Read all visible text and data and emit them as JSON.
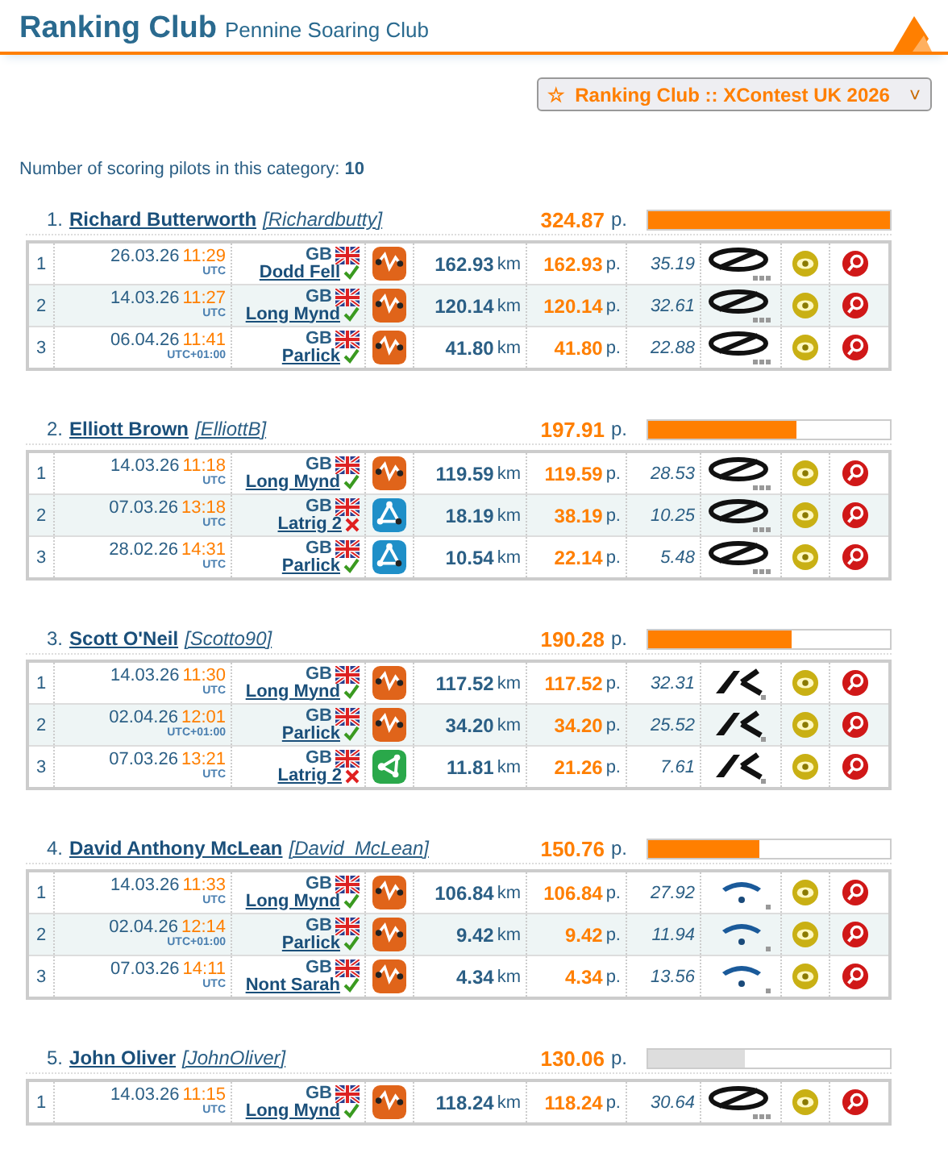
{
  "header": {
    "title": "Ranking Club",
    "subtitle": "Pennine Soaring Club"
  },
  "selector": {
    "star": "☆",
    "label": "Ranking Club :: XContest UK 2026",
    "caret": "˅"
  },
  "count": {
    "label": "Number of scoring pilots in this category:",
    "value": "10"
  },
  "pilots": [
    {
      "rank": "1.",
      "name": "Richard Butterworth",
      "username": "[Richardbutty]",
      "points": "324.87",
      "points_unit": "p.",
      "level": 1,
      "color": "#ff7f00",
      "flights": [
        {
          "num": "1",
          "date": "26.03.26",
          "time": "11:29",
          "tz": "UTC",
          "country": "GB",
          "site": "Dodd Fell",
          "valid": true,
          "route": {
            "kind": "free"
          },
          "distance": "162.93",
          "distance_unit": "km",
          "points": "162.93",
          "points_unit": "p.",
          "speed": "35.19",
          "glider": {
            "kind": "ozone"
          }
        },
        {
          "num": "2",
          "date": "14.03.26",
          "time": "11:27",
          "tz": "UTC",
          "country": "GB",
          "site": "Long Mynd",
          "valid": true,
          "route": {
            "kind": "free"
          },
          "distance": "120.14",
          "distance_unit": "km",
          "points": "120.14",
          "points_unit": "p.",
          "speed": "32.61",
          "glider": {
            "kind": "ozone"
          }
        },
        {
          "num": "3",
          "date": "06.04.26",
          "time": "11:41",
          "tz": "UTC+01:00",
          "country": "GB",
          "site": "Parlick",
          "valid": true,
          "route": {
            "kind": "free"
          },
          "distance": "41.80",
          "distance_unit": "km",
          "points": "41.80",
          "points_unit": "p.",
          "speed": "22.88",
          "glider": {
            "kind": "ozone"
          }
        }
      ]
    },
    {
      "rank": "2.",
      "name": "Elliott Brown",
      "username": "[ElliottB]",
      "points": "197.91",
      "points_unit": "p.",
      "level": 0.61,
      "color": "#ff7f00",
      "flights": [
        {
          "num": "1",
          "date": "14.03.26",
          "time": "11:18",
          "tz": "UTC",
          "country": "GB",
          "site": "Long Mynd",
          "valid": true,
          "route": {
            "kind": "free"
          },
          "distance": "119.59",
          "distance_unit": "km",
          "points": "119.59",
          "points_unit": "p.",
          "speed": "28.53",
          "glider": {
            "kind": "ozone"
          }
        },
        {
          "num": "2",
          "date": "07.03.26",
          "time": "13:18",
          "tz": "UTC",
          "country": "GB",
          "site": "Latrig 2",
          "valid": false,
          "route": {
            "kind": "triangle"
          },
          "distance": "18.19",
          "distance_unit": "km",
          "points": "38.19",
          "points_unit": "p.",
          "speed": "10.25",
          "glider": {
            "kind": "ozone"
          }
        },
        {
          "num": "3",
          "date": "28.02.26",
          "time": "14:31",
          "tz": "UTC",
          "country": "GB",
          "site": "Parlick",
          "valid": true,
          "route": {
            "kind": "triangle"
          },
          "distance": "10.54",
          "distance_unit": "km",
          "points": "22.14",
          "points_unit": "p.",
          "speed": "5.48",
          "glider": {
            "kind": "ozone"
          }
        }
      ]
    },
    {
      "rank": "3.",
      "name": "Scott O'Neil",
      "username": "[Scotto90]",
      "points": "190.28",
      "points_unit": "p.",
      "level": 0.59,
      "color": "#ff7f00",
      "flights": [
        {
          "num": "1",
          "date": "14.03.26",
          "time": "11:30",
          "tz": "UTC",
          "country": "GB",
          "site": "Long Mynd",
          "valid": true,
          "route": {
            "kind": "free"
          },
          "distance": "117.52",
          "distance_unit": "km",
          "points": "117.52",
          "points_unit": "p.",
          "speed": "32.31",
          "glider": {
            "kind": "ak"
          }
        },
        {
          "num": "2",
          "date": "02.04.26",
          "time": "12:01",
          "tz": "UTC+01:00",
          "country": "GB",
          "site": "Parlick",
          "valid": true,
          "route": {
            "kind": "free"
          },
          "distance": "34.20",
          "distance_unit": "km",
          "points": "34.20",
          "points_unit": "p.",
          "speed": "25.52",
          "glider": {
            "kind": "ak"
          }
        },
        {
          "num": "3",
          "date": "07.03.26",
          "time": "13:21",
          "tz": "UTC",
          "country": "GB",
          "site": "Latrig 2",
          "valid": false,
          "route": {
            "kind": "fai"
          },
          "distance": "11.81",
          "distance_unit": "km",
          "points": "21.26",
          "points_unit": "p.",
          "speed": "7.61",
          "glider": {
            "kind": "ak"
          }
        }
      ]
    },
    {
      "rank": "4.",
      "name": "David Anthony McLean",
      "username": "[David_McLean]",
      "points": "150.76",
      "points_unit": "p.",
      "level": 0.46,
      "color": "#ff7f00",
      "flights": [
        {
          "num": "1",
          "date": "14.03.26",
          "time": "11:33",
          "tz": "UTC",
          "country": "GB",
          "site": "Long Mynd",
          "valid": true,
          "route": {
            "kind": "free"
          },
          "distance": "106.84",
          "distance_unit": "km",
          "points": "106.84",
          "points_unit": "p.",
          "speed": "27.92",
          "glider": {
            "kind": "wing"
          }
        },
        {
          "num": "2",
          "date": "02.04.26",
          "time": "12:14",
          "tz": "UTC+01:00",
          "country": "GB",
          "site": "Parlick",
          "valid": true,
          "route": {
            "kind": "free"
          },
          "distance": "9.42",
          "distance_unit": "km",
          "points": "9.42",
          "points_unit": "p.",
          "speed": "11.94",
          "glider": {
            "kind": "wing"
          }
        },
        {
          "num": "3",
          "date": "07.03.26",
          "time": "14:11",
          "tz": "UTC",
          "country": "GB",
          "site": "Nont Sarah",
          "valid": true,
          "route": {
            "kind": "free"
          },
          "distance": "4.34",
          "distance_unit": "km",
          "points": "4.34",
          "points_unit": "p.",
          "speed": "13.56",
          "glider": {
            "kind": "wing"
          }
        }
      ]
    },
    {
      "rank": "5.",
      "name": "John Oliver",
      "username": "[JohnOliver]",
      "points": "130.06",
      "points_unit": "p.",
      "level": 0.4,
      "color": "#dddddd",
      "flights": [
        {
          "num": "1",
          "date": "14.03.26",
          "time": "11:15",
          "tz": "UTC",
          "country": "GB",
          "site": "Long Mynd",
          "valid": true,
          "route": {
            "kind": "free"
          },
          "distance": "118.24",
          "distance_unit": "km",
          "points": "118.24",
          "points_unit": "p.",
          "speed": "30.64",
          "glider": {
            "kind": "ozone"
          }
        }
      ]
    }
  ]
}
